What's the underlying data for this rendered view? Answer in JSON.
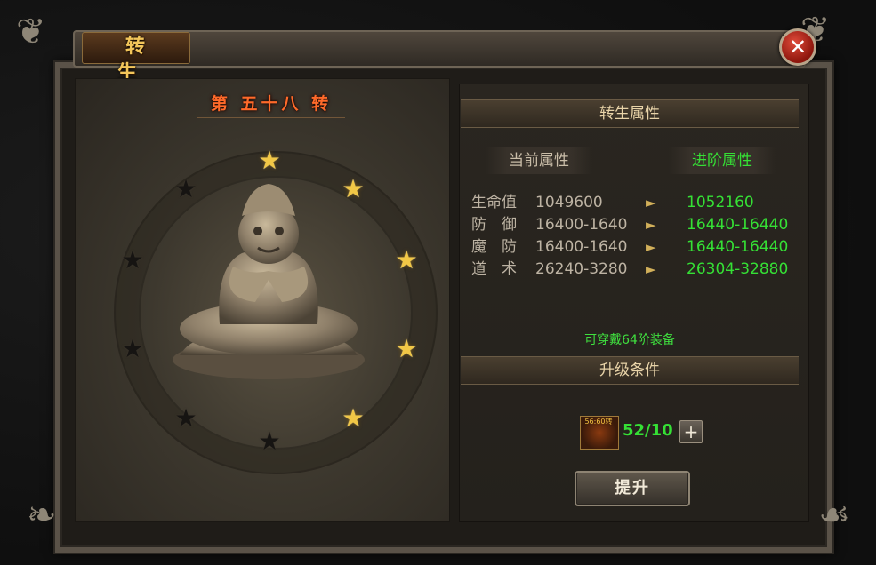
{
  "window": {
    "title": "转 生",
    "close_label": "✕"
  },
  "rebirth": {
    "rank_title": "第 五十八 转",
    "stars": [
      {
        "state": "lit"
      },
      {
        "state": "lit"
      },
      {
        "state": "lit"
      },
      {
        "state": "lit"
      },
      {
        "state": "lit"
      },
      {
        "state": "dim"
      },
      {
        "state": "dim"
      },
      {
        "state": "dim"
      },
      {
        "state": "dim"
      },
      {
        "state": "dim"
      }
    ]
  },
  "attributes": {
    "section_title": "转生属性",
    "current_header": "当前属性",
    "next_header": "进阶属性",
    "rows": [
      {
        "label": "生命值",
        "current": "1049600",
        "next": "1052160"
      },
      {
        "label": "防　御",
        "current": "16400-1640",
        "next": "16440-16440"
      },
      {
        "label": "魔　防",
        "current": "16400-1640",
        "next": "16440-16440"
      },
      {
        "label": "道　术",
        "current": "26240-3280",
        "next": "26304-32880"
      }
    ],
    "equip_note": "可穿戴64阶装备"
  },
  "requirements": {
    "section_title": "升级条件",
    "item_label": "56:60转",
    "item_count": "52/10",
    "plus_label": "+",
    "upgrade_label": "提升"
  },
  "colors": {
    "lit_star": "#f1c746",
    "next_value": "#35e035",
    "rank_title": "#ff6a2a"
  },
  "icons": {
    "close": "close-icon",
    "arrow": "arrow-right-icon",
    "star": "star-icon",
    "plus": "plus-icon"
  }
}
